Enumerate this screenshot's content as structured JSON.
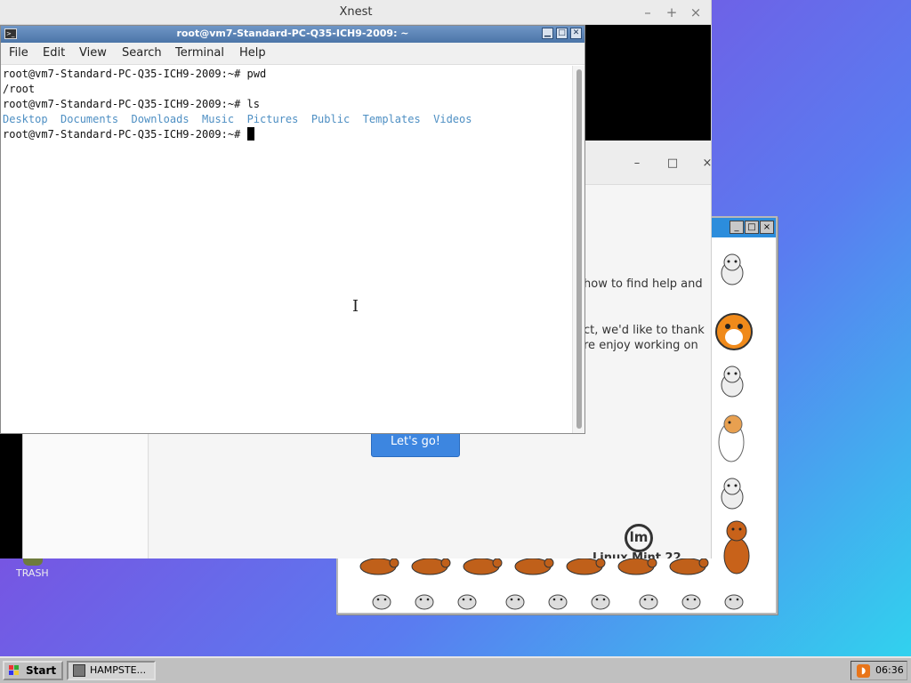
{
  "xnest": {
    "title": "Xnest",
    "minimize": "–",
    "maximize": "+",
    "close": "×"
  },
  "welcome": {
    "minimize": "–",
    "maximize": "□",
    "close": "×",
    "line1": "how to find help and",
    "line2": "ct, we'd like to thank",
    "line3": "re enjoy working on",
    "button": "Let's go!",
    "logo": "lm",
    "caption": "Linux Mint 22"
  },
  "hampster": {
    "minimize": "_",
    "maximize": "□",
    "close": "×"
  },
  "terminal": {
    "title": "root@vm7-Standard-PC-Q35-ICH9-2009: ~",
    "menu": [
      "File",
      "Edit",
      "View",
      "Search",
      "Terminal",
      "Help"
    ],
    "prompt": "root@vm7-Standard-PC-Q35-ICH9-2009:~# ",
    "lines": [
      {
        "cmd": "pwd"
      },
      {
        "out": "/root"
      },
      {
        "cmd": "ls"
      }
    ],
    "dirs": [
      "Desktop",
      "Documents",
      "Downloads",
      "Music",
      "Pictures",
      "Public",
      "Templates",
      "Videos"
    ],
    "current_input": ""
  },
  "desktop": {
    "trash_label": "TRASH"
  },
  "taskbar": {
    "start_label": "Start",
    "task_label": "HAMPSTE...",
    "clock": "06:36"
  }
}
